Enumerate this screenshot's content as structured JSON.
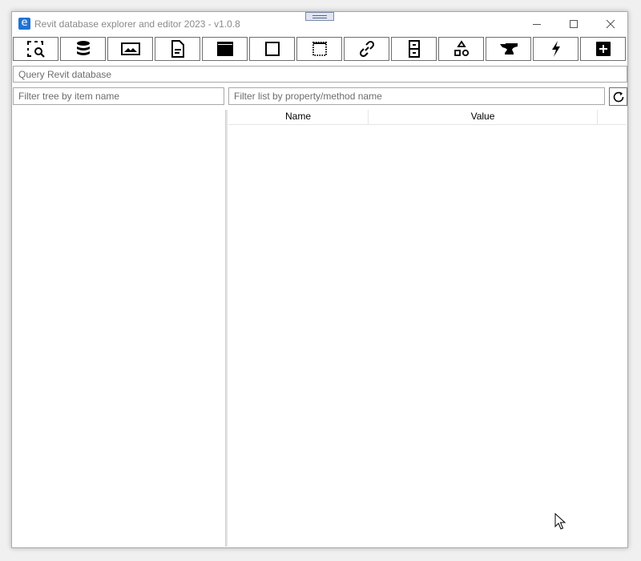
{
  "window": {
    "title": "Revit database explorer and editor 2023 - v1.0.8",
    "app_icon_letter": "e"
  },
  "title_buttons": [
    {
      "name": "minimize-icon"
    },
    {
      "name": "maximize-icon"
    },
    {
      "name": "close-icon"
    }
  ],
  "toolbar": {
    "buttons": [
      {
        "icon": "selection-search-icon"
      },
      {
        "icon": "database-icon"
      },
      {
        "icon": "image-icon"
      },
      {
        "icon": "document-icon"
      },
      {
        "icon": "window-icon"
      },
      {
        "icon": "square-icon"
      },
      {
        "icon": "dotted-square-icon"
      },
      {
        "icon": "link-icon"
      },
      {
        "icon": "cabinet-icon"
      },
      {
        "icon": "shapes-icon"
      },
      {
        "icon": "anvil-icon"
      },
      {
        "icon": "lightning-icon"
      },
      {
        "icon": "plus-square-icon"
      }
    ]
  },
  "query": {
    "placeholder": "Query Revit database"
  },
  "filters": {
    "tree_placeholder": "Filter tree by item name",
    "list_placeholder": "Filter list by property/method name"
  },
  "list": {
    "columns": [
      "Name",
      "Value"
    ]
  },
  "colors": {
    "accent": "#1f72d6",
    "border": "#6e6e6e",
    "title_text": "#8a8a8a"
  }
}
